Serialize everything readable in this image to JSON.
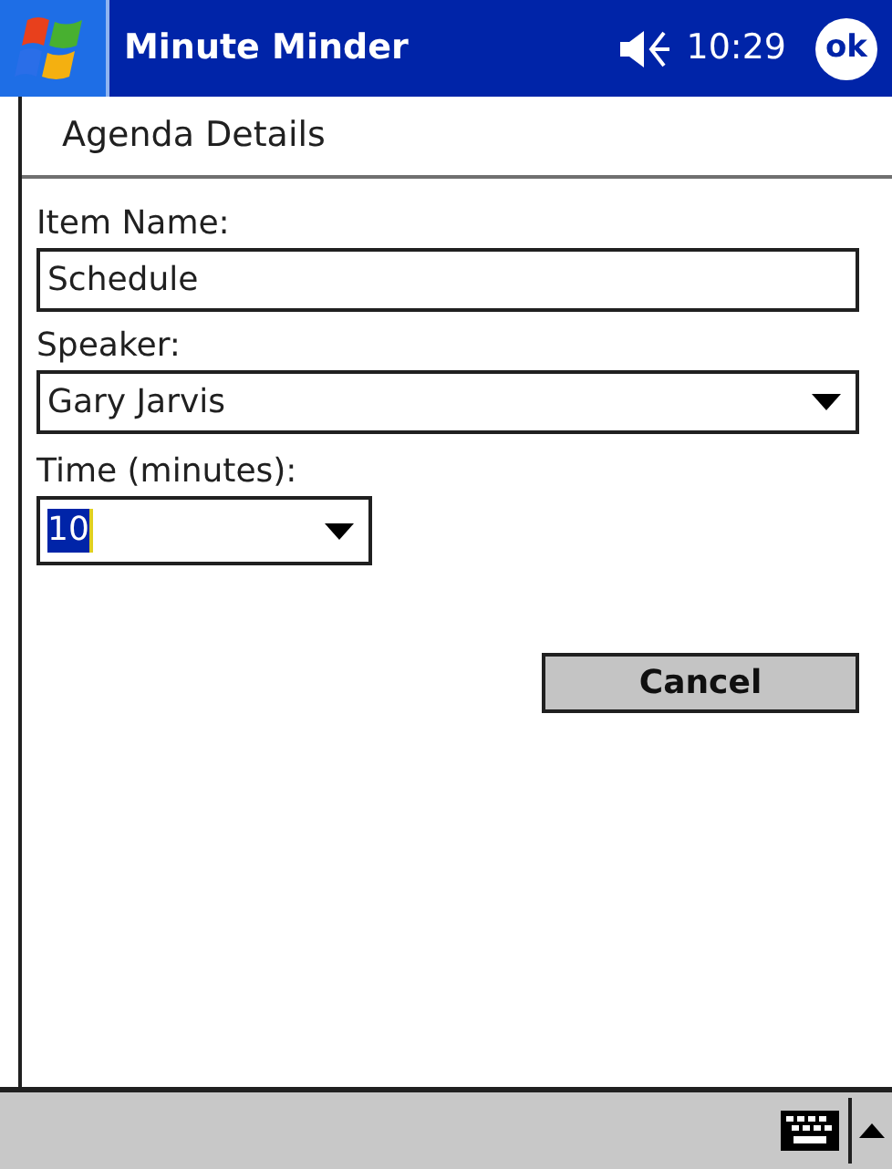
{
  "title_bar": {
    "title": "Minute Minder",
    "time": "10:29",
    "ok": "ok"
  },
  "header": {
    "title": "Agenda Details"
  },
  "form": {
    "item_name": {
      "label": "Item Name:",
      "value": "Schedule"
    },
    "speaker": {
      "label": "Speaker:",
      "value": "Gary Jarvis"
    },
    "time": {
      "label": "Time (minutes):",
      "value": "10",
      "text_selected": true
    }
  },
  "buttons": [
    {
      "label": "Cancel"
    }
  ]
}
